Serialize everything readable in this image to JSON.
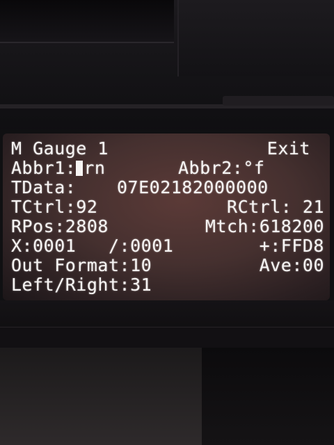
{
  "screen": {
    "title": "M Gauge 1",
    "exit_label": "Exit",
    "abbr1": {
      "label": "Abbr1:",
      "value": "rn"
    },
    "abbr2": {
      "label": "Abbr2:",
      "value": "°f"
    },
    "tdata": {
      "label": "TData:",
      "value": "07E02182000000"
    },
    "tctrl": {
      "label": "TCtrl:",
      "value": "92"
    },
    "rctrl": {
      "label": "RCtrl:",
      "value": "21"
    },
    "rpos": {
      "label": "RPos:",
      "value": "2808"
    },
    "mtch": {
      "label": "Mtch:",
      "value": "618200"
    },
    "x": {
      "label": "X:",
      "value": "0001"
    },
    "div": {
      "label": "/:",
      "value": "0001"
    },
    "plus": {
      "label": "+:",
      "value": "FFD8"
    },
    "out_format": {
      "label": "Out Format:",
      "value": "10"
    },
    "ave": {
      "label": "Ave:",
      "value": "00"
    },
    "left_right": {
      "label": "Left/Right:",
      "value": "31"
    }
  }
}
